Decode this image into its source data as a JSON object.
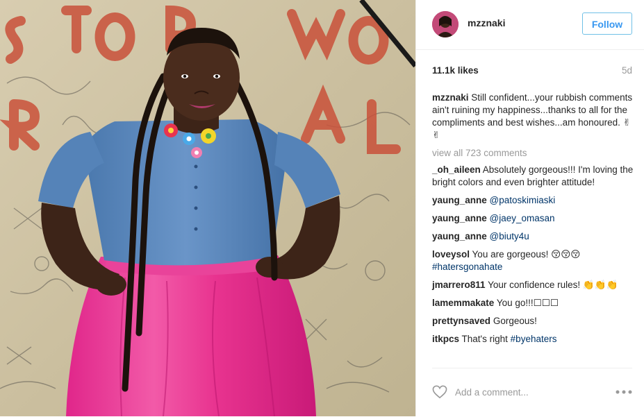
{
  "post": {
    "username": "mzznaki",
    "follow_label": "Follow",
    "likes": "11.1k likes",
    "time": "5d",
    "view_all": "view all 723 comments",
    "caption": {
      "user": "mzznaki",
      "text": "Still confident...your rubbish comments ain't ruining my happiness...thanks to all for the compliments and best wishes...am honoured. ✌✌"
    },
    "add_comment_placeholder": "Add a comment..."
  },
  "comments": [
    {
      "user": "_oh_aileen",
      "text": "Absolutely gorgeous!!! I'm loving the bright colors and even brighter attitude!"
    },
    {
      "user": "yaung_anne",
      "text": "",
      "tag": "@patoskimiaski"
    },
    {
      "user": "yaung_anne",
      "text": "",
      "tag": "@jaey_omasan"
    },
    {
      "user": "yaung_anne",
      "text": "",
      "tag": "@biuty4u"
    },
    {
      "user": "loveysol",
      "text": "You are gorgeous! 😚😚😚",
      "tag": "#hatersgonahate"
    },
    {
      "user": "jmarrero811",
      "text": "Your confidence rules! 👏👏👏",
      "tag": ""
    },
    {
      "user": "lamemmakate",
      "text": "You go!!!☐☐☐",
      "tag": ""
    },
    {
      "user": "prettynsaved",
      "text": "Gorgeous!",
      "tag": ""
    },
    {
      "user": "itkpcs",
      "text": "That's right",
      "tag": "#byehaters"
    }
  ],
  "colors": {
    "accent_blue": "#3897f0",
    "follow_border": "#70c0e7",
    "tag_color": "#003569",
    "muted": "#999999",
    "text": "#262626",
    "divider": "#efefef"
  },
  "icons": {
    "like": "heart-outline-icon",
    "more": "ellipsis-icon"
  }
}
